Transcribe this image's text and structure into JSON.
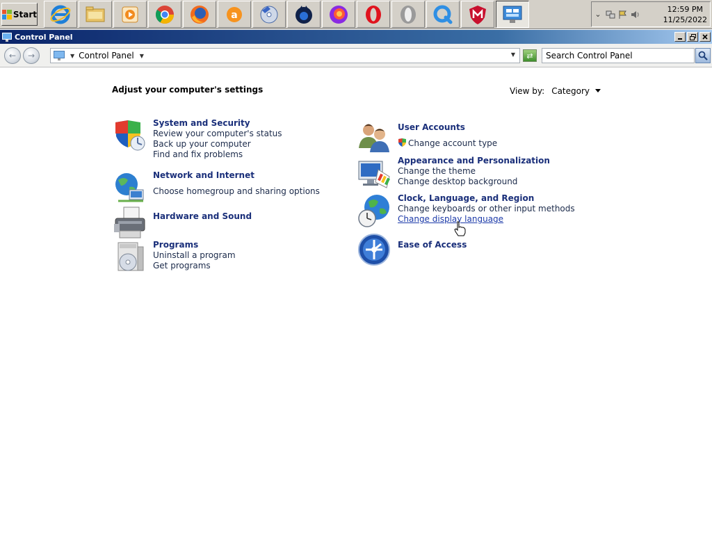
{
  "taskbar": {
    "start_label": "Start",
    "apps": [
      {
        "name": "internet-explorer-icon"
      },
      {
        "name": "file-explorer-icon"
      },
      {
        "name": "media-player-icon"
      },
      {
        "name": "chrome-icon"
      },
      {
        "name": "firefox-icon"
      },
      {
        "name": "avast-icon"
      },
      {
        "name": "disc-burner-icon"
      },
      {
        "name": "waterfox-icon"
      },
      {
        "name": "firefox-nightly-icon"
      },
      {
        "name": "opera-icon"
      },
      {
        "name": "opera-gx-icon"
      },
      {
        "name": "quicktime-icon"
      },
      {
        "name": "mcafee-icon"
      },
      {
        "name": "control-panel-icon",
        "active": true
      }
    ],
    "clock": {
      "time": "12:59 PM",
      "date": "11/25/2022"
    }
  },
  "window": {
    "title": "Control Panel",
    "address": {
      "crumb": "Control Panel"
    },
    "search": {
      "placeholder": "Search Control Panel"
    }
  },
  "content": {
    "heading": "Adjust your computer's settings",
    "view_by": {
      "label": "View by:",
      "value": "Category"
    },
    "categories": [
      {
        "title": "System and Security",
        "icon": "shield-icon",
        "links": [
          "Review your computer's status",
          "Back up your computer",
          "Find and fix problems"
        ]
      },
      {
        "title": "Network and Internet",
        "icon": "network-globe-icon",
        "links": [
          "Choose homegroup and sharing options"
        ]
      },
      {
        "title": "Hardware and Sound",
        "icon": "printer-icon",
        "links": []
      },
      {
        "title": "Programs",
        "icon": "programs-disc-icon",
        "links": [
          "Uninstall a program",
          "Get programs"
        ]
      },
      {
        "title": "User Accounts",
        "icon": "users-icon",
        "links": [
          "Change account type"
        ]
      },
      {
        "title": "Appearance and Personalization",
        "icon": "monitor-palette-icon",
        "links": [
          "Change the theme",
          "Change desktop background"
        ]
      },
      {
        "title": "Clock, Language, and Region",
        "icon": "clock-globe-icon",
        "links": [
          "Change keyboards or other input methods",
          "Change display language"
        ]
      },
      {
        "title": "Ease of Access",
        "icon": "ease-of-access-icon",
        "links": []
      }
    ]
  },
  "colors": {
    "link_title": "#1a2f7a",
    "link": "#1b2a4a",
    "titlebar": "#0a246a"
  }
}
